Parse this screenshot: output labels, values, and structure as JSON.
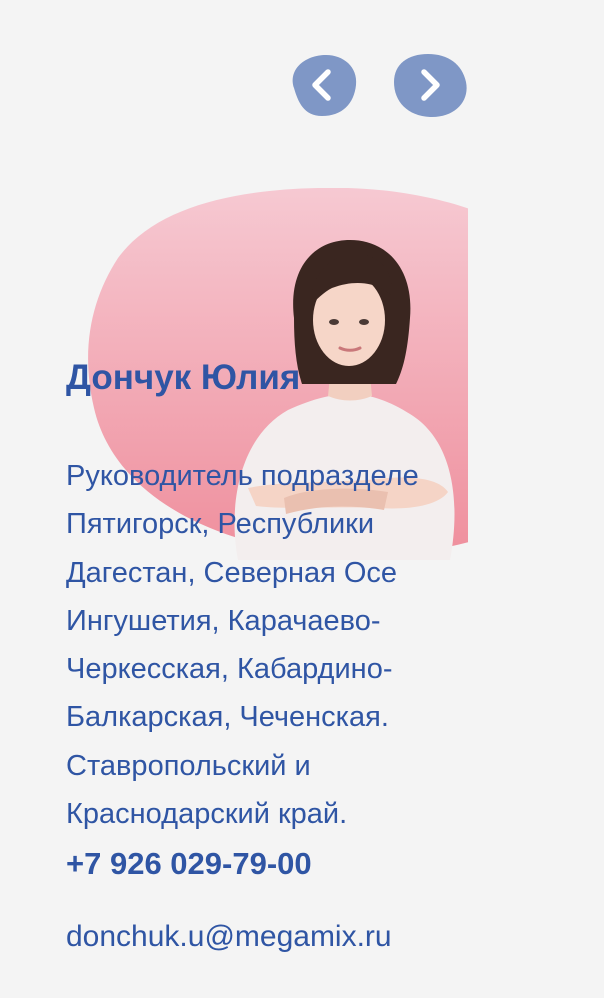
{
  "navigation": {
    "prev_icon": "chevron-left-icon",
    "next_icon": "chevron-right-icon",
    "button_color": "#7f97c6",
    "icon_color": "#ffffff"
  },
  "person": {
    "name": "Дончук Юлия",
    "role_lines": [
      "Руководитель подразделе",
      "Пятигорск, Республики",
      "Дагестан, Северная Осе",
      "Ингушетия, Карачаево-",
      "Черкесская, Кабардино-",
      "Балкарская, Чеченская.",
      "Ставропольский и",
      "Краснодарский край."
    ],
    "phone": "+7 926 029-79-00",
    "email": "donchuk.u@megamix.ru"
  },
  "colors": {
    "page_background": "#f4f4f4",
    "text": "#2f55a4",
    "blob_top": "#f6c9d2",
    "blob_bottom": "#ef8f9d"
  }
}
